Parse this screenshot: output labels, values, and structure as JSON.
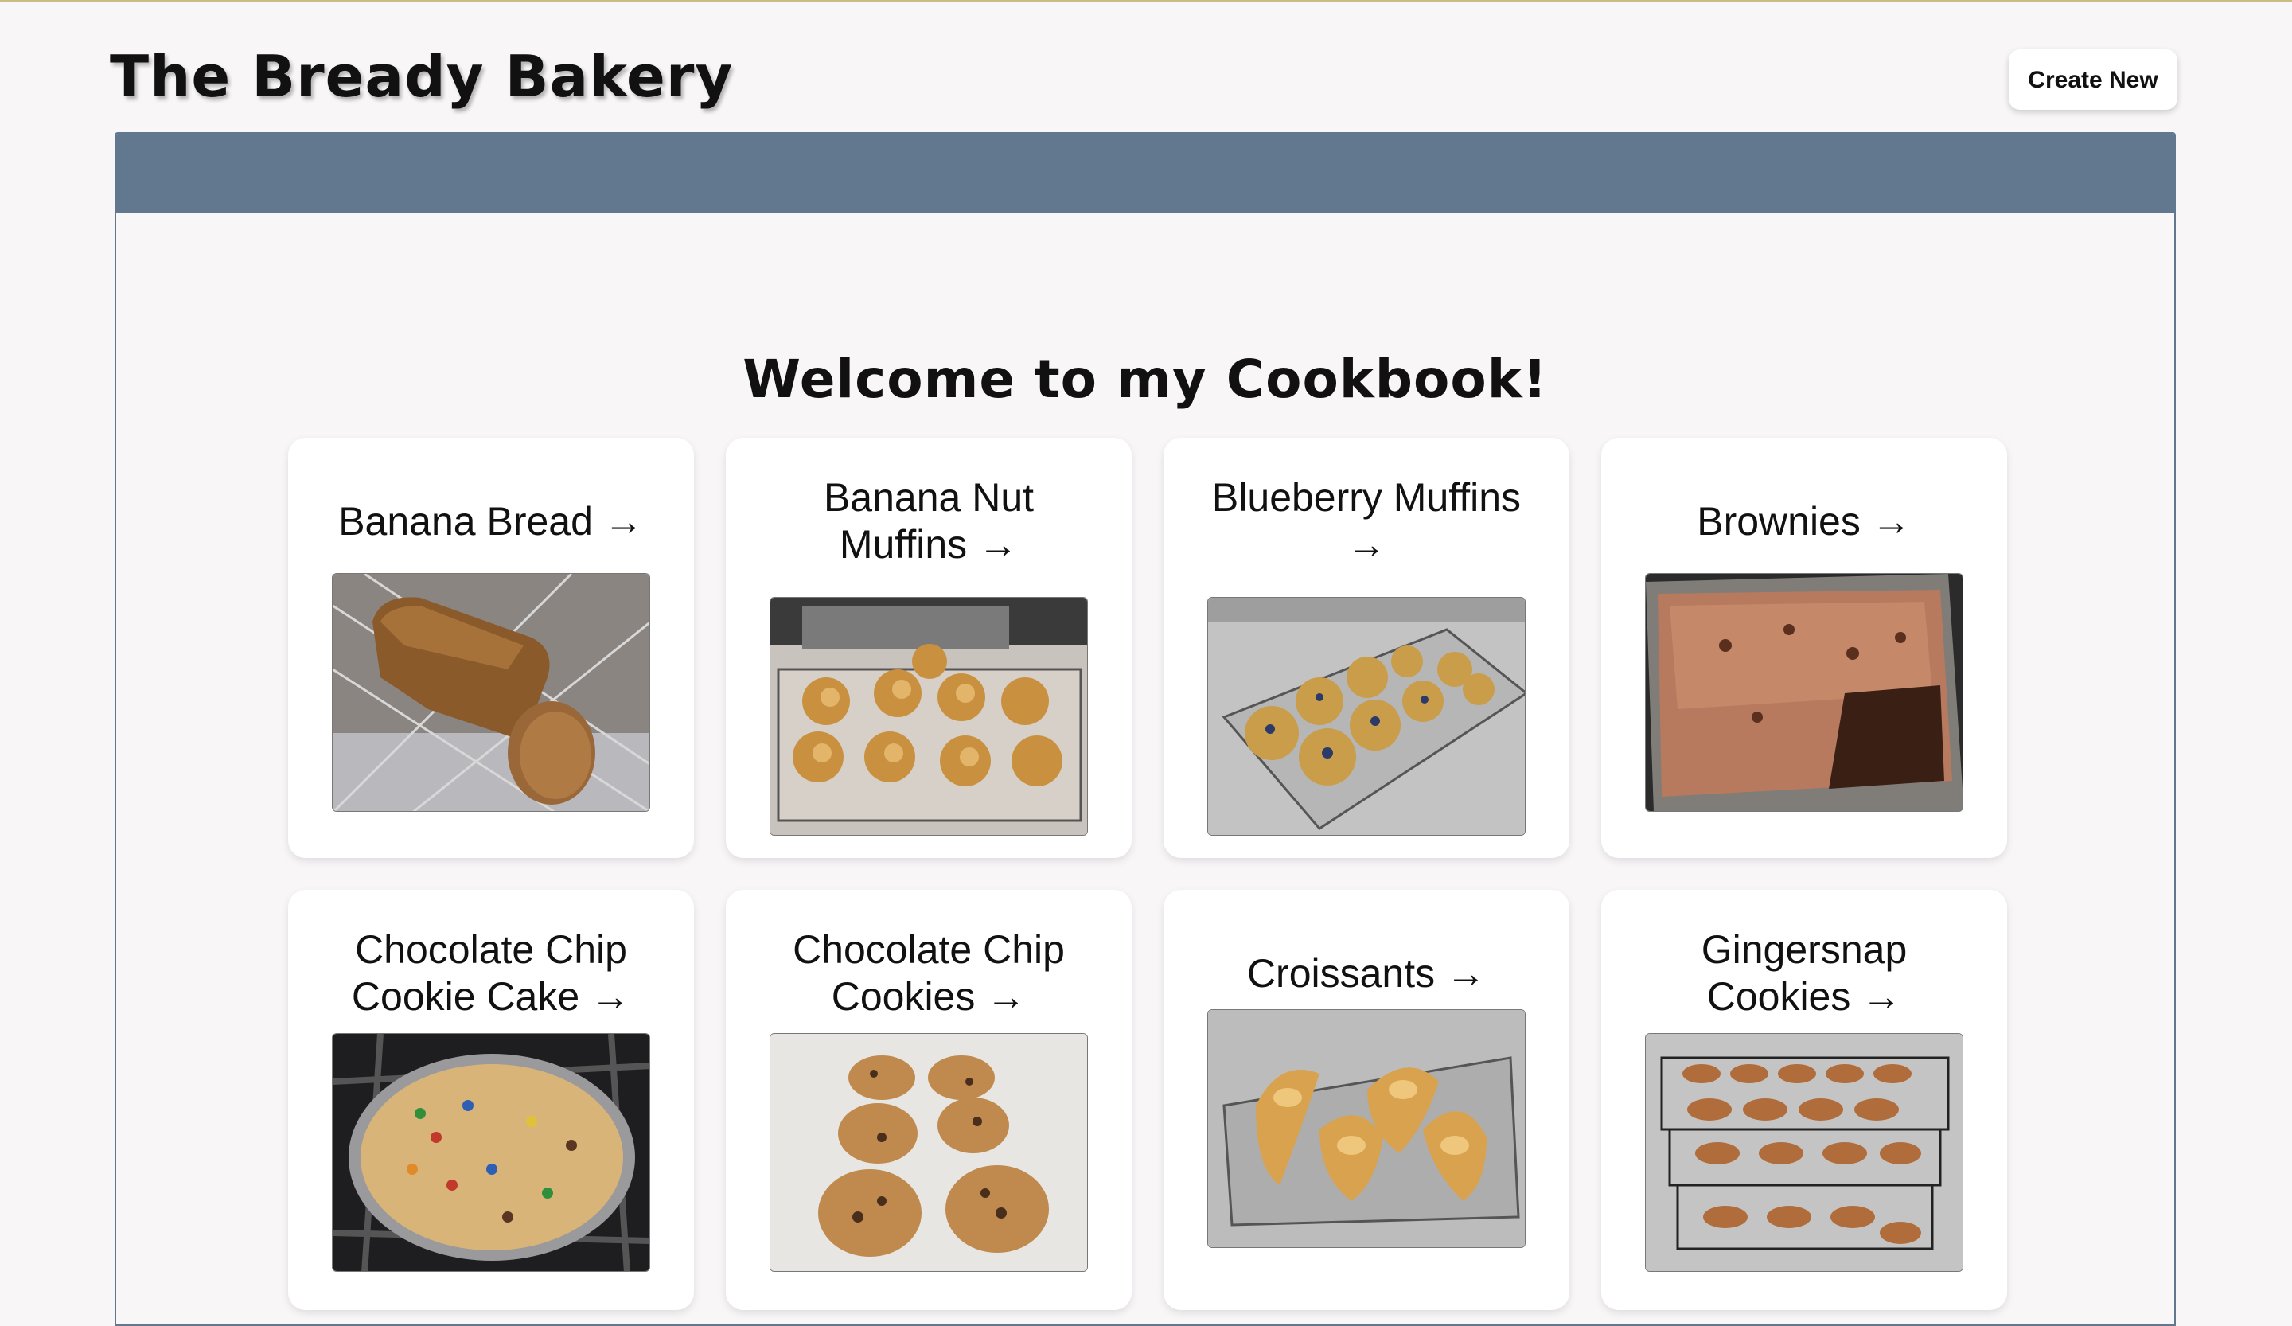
{
  "header": {
    "site_title": "The Bready Bakery",
    "create_label": "Create New"
  },
  "main": {
    "welcome": "Welcome to my Cookbook!"
  },
  "recipes": [
    {
      "title": "Banana Bread",
      "arrow": "→",
      "photo": "banana-bread-photo"
    },
    {
      "title": "Banana Nut Muffins",
      "arrow": "→",
      "photo": "banana-nut-muffins-photo"
    },
    {
      "title": "Blueberry Muffins",
      "arrow": "→",
      "photo": "blueberry-muffins-photo"
    },
    {
      "title": "Brownies",
      "arrow": "→",
      "photo": "brownies-photo"
    },
    {
      "title": "Chocolate Chip Cookie Cake",
      "arrow": "→",
      "photo": "cookie-cake-photo"
    },
    {
      "title": "Chocolate Chip Cookies",
      "arrow": "→",
      "photo": "chocolate-chip-cookies-photo"
    },
    {
      "title": "Croissants",
      "arrow": "→",
      "photo": "croissants-photo"
    },
    {
      "title": "Gingersnap Cookies",
      "arrow": "→",
      "photo": "gingersnap-cookies-photo"
    }
  ],
  "colors": {
    "page_bg": "#f8f6f7",
    "band": "#62788f",
    "card_bg": "#ffffff"
  }
}
